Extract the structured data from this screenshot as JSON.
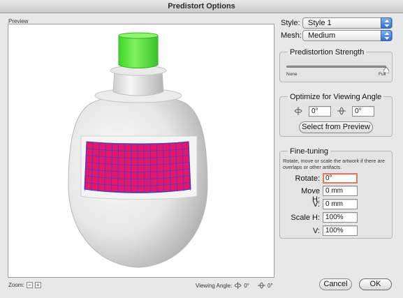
{
  "window": {
    "title": "Predistort Options"
  },
  "preview": {
    "label": "Preview",
    "zoom_label": "Zoom:",
    "zoom_out": "−",
    "zoom_in": "+",
    "viewing_angle_label": "Viewing Angle:",
    "horizontal_angle": "0°",
    "vertical_angle": "0°"
  },
  "style": {
    "label": "Style:",
    "value": "Style 1"
  },
  "mesh": {
    "label": "Mesh:",
    "value": "Medium"
  },
  "strength": {
    "title": "Predistortion Strength",
    "min_label": "None",
    "max_label": "Full",
    "value_fraction": 1.0
  },
  "viewing_angle": {
    "title": "Optimize for Viewing Angle",
    "horizontal_value": "0°",
    "vertical_value": "0°",
    "select_button": "Select from Preview"
  },
  "fine_tuning": {
    "title": "Fine-tuning",
    "description": "Rotate, move or scale the artwork if there are overlaps or other artifacts.",
    "rotate_label": "Rotate:",
    "rotate_value": "0°",
    "move_h_label": "Move H:",
    "move_h_value": "0 mm",
    "move_v_label": "V:",
    "move_v_value": "0 mm",
    "scale_h_label": "Scale H:",
    "scale_h_value": "100%",
    "scale_v_label": "V:",
    "scale_v_value": "100%"
  },
  "buttons": {
    "cancel": "Cancel",
    "ok": "OK"
  },
  "colors": {
    "cap": "#55e83c",
    "label_fill": "#e0196a",
    "grid_lines": "#4a35d8",
    "accent_blue": "#2d6fd8",
    "focus_ring": "#d97b63"
  }
}
